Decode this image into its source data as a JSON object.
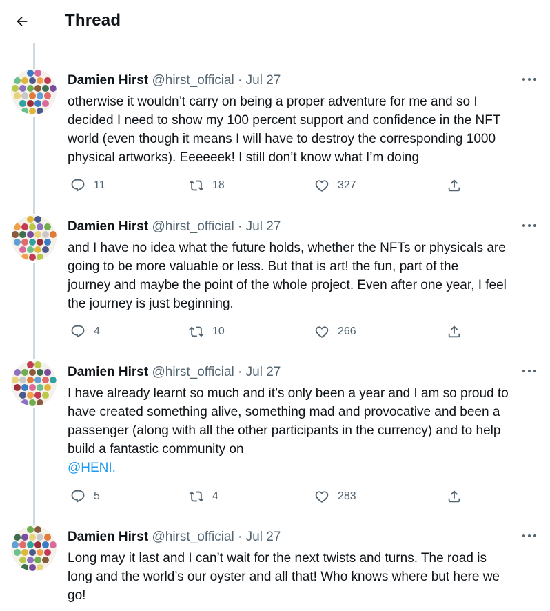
{
  "header": {
    "title": "Thread",
    "back_icon": "arrow-left-icon"
  },
  "tweets": [
    {
      "name": "Damien Hirst",
      "handle": "@hirst_official",
      "dot": "·",
      "date": "Jul 27",
      "lines": [
        "otherwise it wouldn’t carry on being a proper adventure for me and so I",
        "decided I need to show my 100 percent support and confidence in the NFT",
        "world (even though it means I will have to destroy the corresponding 1000",
        "physical artworks). Eeeeeek! I still don’t know what I’m doing"
      ],
      "mention": "",
      "replies": "11",
      "retweets": "18",
      "likes": "327"
    },
    {
      "name": "Damien Hirst",
      "handle": "@hirst_official",
      "dot": "·",
      "date": "Jul 27",
      "lines": [
        "and I have no idea what the future holds, whether the NFTs or physicals are",
        "going to be more valuable or less. But that is art! the fun, part of the",
        "journey and maybe the point of the whole project. Even after one year, I feel",
        "the journey is just beginning."
      ],
      "mention": "",
      "replies": "4",
      "retweets": "10",
      "likes": "266"
    },
    {
      "name": "Damien Hirst",
      "handle": "@hirst_official",
      "dot": "·",
      "date": "Jul 27",
      "lines": [
        "I have already learnt so much and it’s only been a year and I am so proud to",
        "have created something alive, something mad and provocative and been a",
        "passenger (along with all the other participants in the currency) and to help",
        "build a fantastic community on"
      ],
      "mention": "@HENI.",
      "replies": "5",
      "retweets": "4",
      "likes": "283"
    },
    {
      "name": "Damien Hirst",
      "handle": "@hirst_official",
      "dot": "·",
      "date": "Jul 27",
      "lines": [
        "Long may it last and I can’t wait for the next twists and turns. The road is",
        "long and the world’s our oyster and all that! Who knows where but here we",
        "go!"
      ],
      "mention": "",
      "replies": "",
      "retweets": "",
      "likes": ""
    }
  ],
  "icons": {
    "reply": "reply-icon",
    "retweet": "retweet-icon",
    "like": "heart-icon",
    "share": "share-icon",
    "more": "more-icon"
  },
  "colors": {
    "text": "#0f1419",
    "secondary": "#536471",
    "link": "#1d9bf0",
    "thread_line": "#cfd9de"
  }
}
